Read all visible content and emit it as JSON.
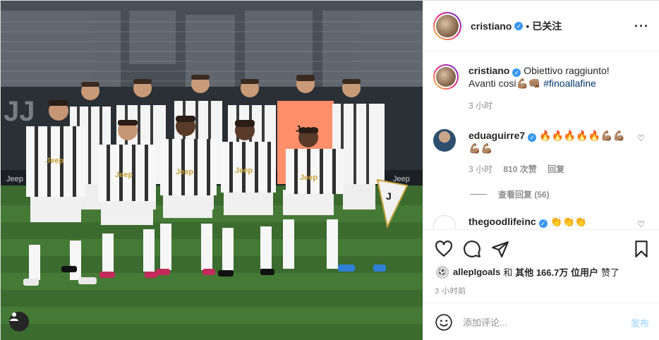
{
  "header": {
    "username": "cristiano",
    "separator": "•",
    "follow_state": "已关注",
    "more_icon": "more-horizontal-icon"
  },
  "caption": {
    "username": "cristiano",
    "text": "Obiettivo raggiunto! Avanti cosi",
    "emojis": "💪🏽👊🏽",
    "hashtag": "#finoallafine",
    "time": "3 小时"
  },
  "comments": [
    {
      "username": "eduaguirre7",
      "text": "🔥🔥🔥🔥🔥💪🏽💪🏽💪🏽💪🏽",
      "time": "3 小时",
      "likes": "810 次赞",
      "reply_label": "回复"
    },
    {
      "username": "thegoodlifeinc",
      "text": "👏👏👏"
    }
  ],
  "view_replies": "查看回复 (56)",
  "actions": {
    "like_icon": "heart-icon",
    "comment_icon": "comment-icon",
    "share_icon": "paper-plane-icon",
    "save_icon": "bookmark-icon"
  },
  "likes_line": {
    "first_liker": "allepIgoals",
    "joiner": "和",
    "others": "其他 166.7万 位用户",
    "suffix": "赞了"
  },
  "timestamp": "3 小时前",
  "add_comment": {
    "placeholder": "添加评论...",
    "post_label": "发布"
  },
  "photo": {
    "jersey_text": "Jeep",
    "banner_text": "Jeep"
  }
}
